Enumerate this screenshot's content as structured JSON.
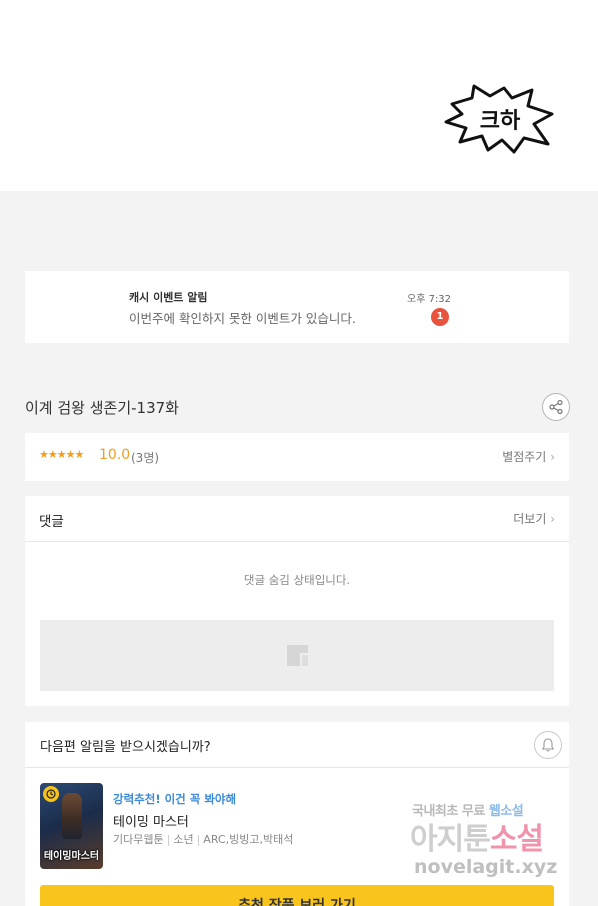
{
  "comic": {
    "sfx_text": "크하"
  },
  "notice": {
    "title": "캐시 이벤트 알림",
    "body": "이번주에 확인하지 못한 이벤트가 있습니다.",
    "time": "오후 7:32",
    "badge": "1"
  },
  "episode": {
    "title": "이계 검왕 생존기-137화",
    "share_icon": "share-icon"
  },
  "rating": {
    "stars": "★★★★★",
    "score": "10.0",
    "count": "(3명)",
    "rate_link": "별점주기"
  },
  "comments": {
    "title": "댓글",
    "more": "더보기",
    "hidden_text": "댓글 숨김 상태입니다."
  },
  "next": {
    "question": "다음편 알림을 받으시겠습니까?",
    "bell_icon": "bell-icon",
    "rec_tag": "강력추천! 이건 꼭 봐야해",
    "rec_name": "테이밍 마스터",
    "rec_meta": [
      "기다무웹툰",
      "소년",
      "ARC,빙빙고,박태석"
    ],
    "thumb_logo": "테이밍마스터",
    "button": "추천 작품 보러 가기"
  },
  "watermark": {
    "line1_a": "국내최초 무료 ",
    "line1_b": "웹소설",
    "line2_a": "아지툰",
    "line2_b": "소설",
    "line3": "novelagit.xyz"
  },
  "colors": {
    "accent_yellow": "#f9c51c",
    "star_orange": "#f29d1e",
    "badge_red": "#e8533e",
    "link_blue": "#3b8bd9"
  }
}
